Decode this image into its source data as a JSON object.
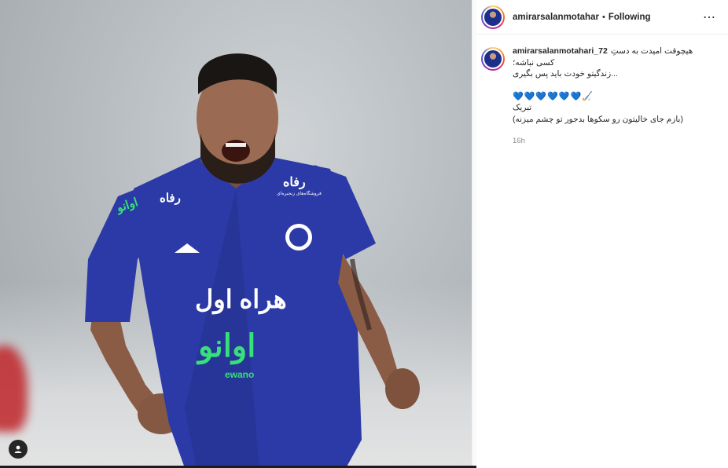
{
  "post": {
    "author": "amirarsalanmotahari_72",
    "author_truncated": "amirarsalanmotahari_",
    "follow_status": "Following",
    "separator": "•",
    "more_label": "⋯",
    "caption": {
      "username": "amirarsalanmotahari_72",
      "line1": "هیچوقت امیدت به دستِ",
      "line2": "کسی نباشه؛",
      "line3": "...زندگیتو خودت باید پس بگیری",
      "hearts": "💙💙💙💙💙💙🏑",
      "line4": "تبریک",
      "line5": "(بازم جای خالیتون رو سکوها بدجور تو چشم میزنه)"
    },
    "time": "16h"
  },
  "photo": {
    "jersey_sponsor": "هراه اول",
    "jersey_main": "اوانو",
    "jersey_brand": "ewano",
    "jersey_top_sponsor": "رفاه",
    "jersey_top_sub": "فروشگاه‌های زنجیره‌ای",
    "sleeve_text": "اوانو"
  },
  "colors": {
    "jersey": "#2b3aa6",
    "jersey_dark": "#1c2670",
    "accent_green": "#37e07a",
    "heart": "#1c5dd9"
  }
}
